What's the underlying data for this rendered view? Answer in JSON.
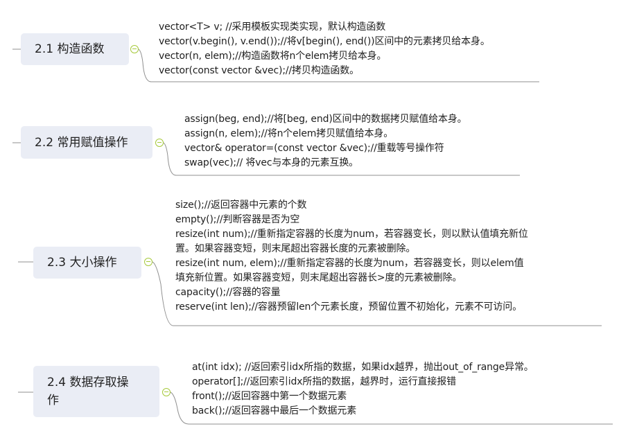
{
  "sections": [
    {
      "title": "2.1 构造函数",
      "lines": [
        "vector<T> v; //采用模板实现类实现，默认构造函数",
        "vector(v.begin(), v.end());//将v[begin(), end())区间中的元素拷贝给本身。",
        "vector(n, elem);//构造函数将n个elem拷贝给本身。",
        "vector(const vector &vec);//拷贝构造函数。"
      ]
    },
    {
      "title": "2.2 常用赋值操作",
      "lines": [
        "assign(beg, end);//将[beg, end)区间中的数据拷贝赋值给本身。",
        "assign(n, elem);//将n个elem拷贝赋值给本身。",
        "vector& operator=(const vector  &vec);//重载等号操作符",
        "swap(vec);// 将vec与本身的元素互换。"
      ]
    },
    {
      "title": "2.3 大小操作",
      "lines": [
        "size();//返回容器中元素的个数",
        "empty();//判断容器是否为空",
        "resize(int num);//重新指定容器的长度为num，若容器变长，则以默认值填充新位",
        "置。如果容器变短，则末尾超出容器长度的元素被删除。",
        "resize(int num, elem);//重新指定容器的长度为num，若容器变长，则以elem值",
        "填充新位置。如果容器变短，则末尾超出容器长>度的元素被删除。",
        "capacity();//容器的容量",
        "reserve(int len);//容器预留len个元素长度，预留位置不初始化，元素不可访问。"
      ]
    },
    {
      "title_lines": [
        "2.4 数据存取操",
        "作"
      ],
      "lines": [
        "at(int idx); //返回索引idx所指的数据，如果idx越界，抛出out_of_range异常。",
        "operator[];//返回索引idx所指的数据，越界时，运行直接报错",
        "front();//返回容器中第一个数据元素",
        "back();//返回容器中最后一个数据元素"
      ]
    }
  ],
  "colors": {
    "topic_fill": "#eaedf5",
    "connector": "#8f8f8f",
    "toggle": "#a6c93a"
  }
}
